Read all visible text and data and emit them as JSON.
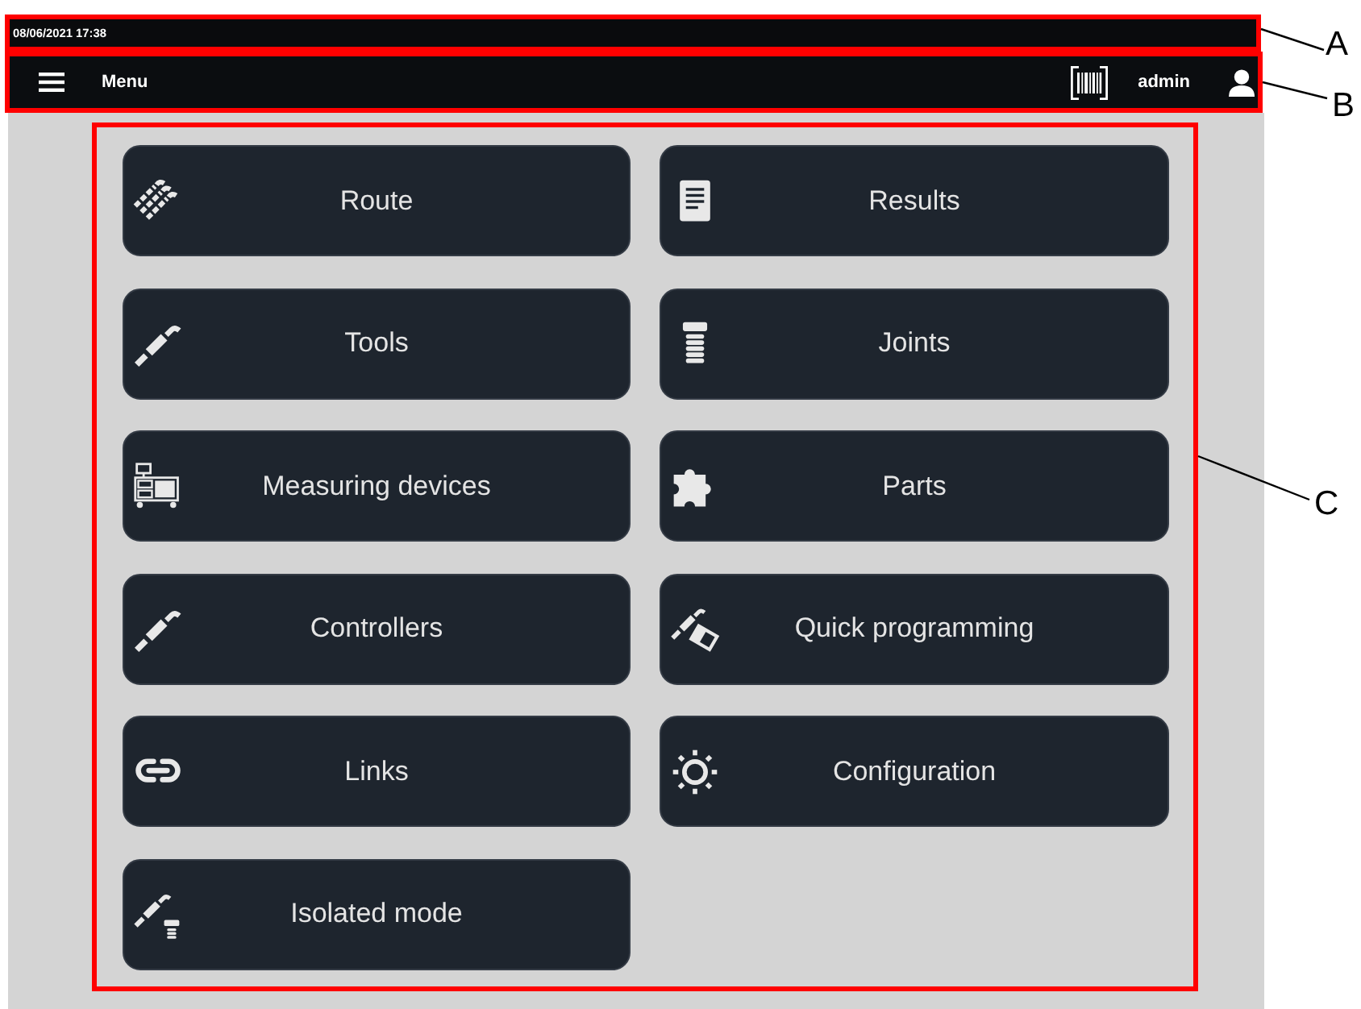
{
  "status_bar": {
    "datetime": "08/06/2021 17:38"
  },
  "header": {
    "menu_label": "Menu",
    "user": "admin"
  },
  "tiles": [
    {
      "label": "Route"
    },
    {
      "label": "Results"
    },
    {
      "label": "Tools"
    },
    {
      "label": "Joints"
    },
    {
      "label": "Measuring devices"
    },
    {
      "label": "Parts"
    },
    {
      "label": "Controllers"
    },
    {
      "label": "Quick programming"
    },
    {
      "label": "Links"
    },
    {
      "label": "Configuration"
    },
    {
      "label": "Isolated mode"
    }
  ],
  "annotations": [
    {
      "label": "A"
    },
    {
      "label": "B"
    },
    {
      "label": "C"
    }
  ]
}
